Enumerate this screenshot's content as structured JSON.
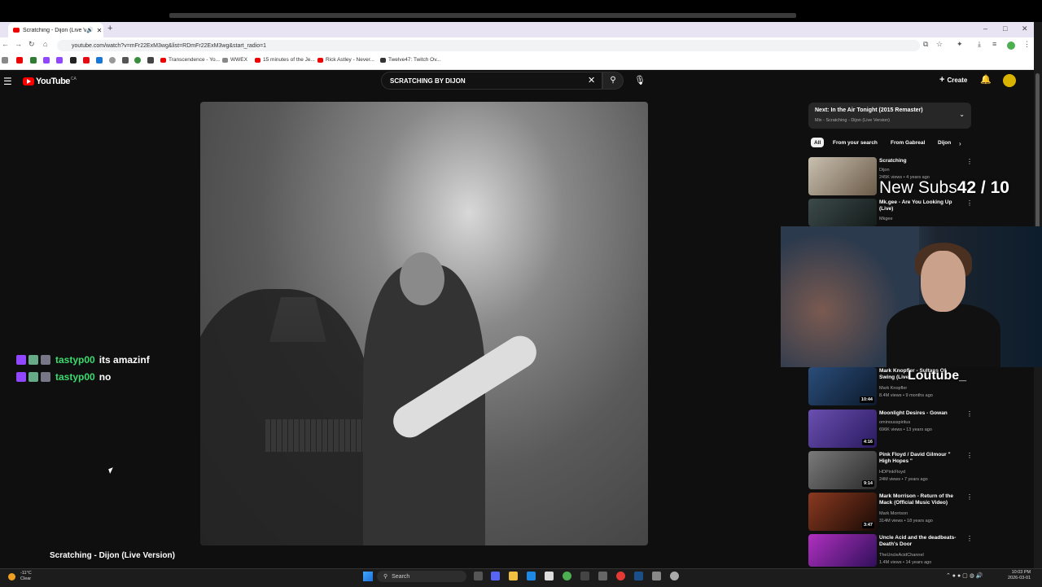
{
  "browser": {
    "tab_title": "Scratching - Dijon (Live Ver",
    "url": "youtube.com/watch?v=mFr22ExM3wg&list=RDmFr22ExM3wg&start_radio=1",
    "bookmarks": [
      "Transcendence - Yo...",
      "WWEX",
      "15 minutes of the Je...",
      "Rick Astley - Never...",
      "Twelve47: Twitch Ov..."
    ]
  },
  "youtube": {
    "logo_text": "YouTube",
    "country": "CA",
    "search_query": "SCRATCHING BY DIJON",
    "create_label": "Create",
    "video_title": "Scratching - Dijon (Live Version)"
  },
  "up_next": {
    "title": "Next: In the Air Tonight (2015 Remaster)",
    "subtitle": "Mix - Scratching - Dijon (Live Version)"
  },
  "chips": [
    "All",
    "From your search",
    "From Gabreal",
    "Dijon"
  ],
  "related": [
    {
      "title": "Scratching",
      "channel": "Dijon",
      "meta": "245K views • 4 years ago",
      "duration": ""
    },
    {
      "title": "Mk.gee - Are You Looking Up (Live)",
      "channel": "Mkgee",
      "meta": "",
      "duration": ""
    },
    {
      "title": "Mark Knopfler - Sultans Of Swing (Live...",
      "channel": "Mark Knopfler",
      "meta": "8.4M views • 9 months ago",
      "duration": "10:44"
    },
    {
      "title": "Moonlight Desires - Gowan",
      "channel": "ominousspiritus",
      "meta": "696K views • 13 years ago",
      "duration": "4:16"
    },
    {
      "title": "Pink Floyd / David Gilmour \" High Hopes \"",
      "channel": "HDPinkFloyd",
      "meta": "24M views • 7 years ago",
      "duration": "9:14"
    },
    {
      "title": "Mark Morrison - Return of the Mack (Official Music Video)",
      "channel": "Mark Morrison",
      "meta": "314M views • 18 years ago",
      "duration": "3:47"
    },
    {
      "title": "Uncle Acid and the deadbeats-Death's Door",
      "channel": "TheUncleAcidChannel",
      "meta": "1.4M views • 14 years ago",
      "duration": ""
    }
  ],
  "chat": [
    {
      "user": "tastyp00",
      "message": "its amazinf"
    },
    {
      "user": "tastyp00",
      "message": "no"
    }
  ],
  "overlay": {
    "subs_label": "New Subs",
    "subs_count": "42 / 10",
    "handle": "Loutube_"
  },
  "taskbar": {
    "temp": "-11°C",
    "weather": "Clear",
    "search_label": "Search",
    "time": "10:03 PM",
    "date": "2026-03-01"
  }
}
